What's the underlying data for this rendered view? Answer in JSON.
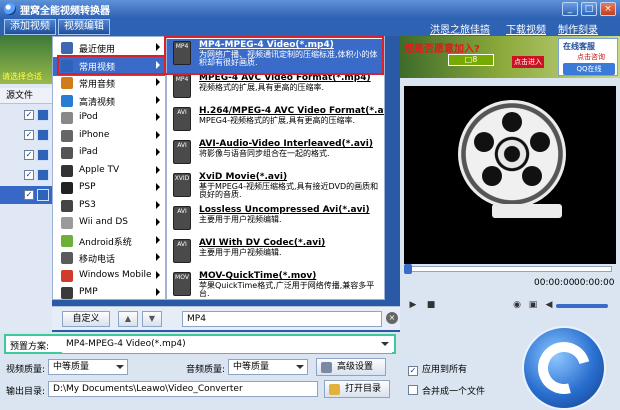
{
  "window": {
    "title": "狸窝全能视频转换器",
    "min": "_",
    "max": "□",
    "close": "×"
  },
  "toolbar": {
    "add_video": "添加视频",
    "edit_video": "视频编辑",
    "links": [
      "洪恩之旅佳搞",
      "下载视频",
      "制作刻录DVD"
    ]
  },
  "left_panel": {
    "ad_text": "请选择合适",
    "file_header": "源文件",
    "check": "✓"
  },
  "categories": [
    {
      "label": "最近使用",
      "icon_color": "#3f66b0",
      "has_arrow": true
    },
    {
      "label": "常用视频",
      "icon_color": "#2d63b8",
      "has_arrow": true,
      "active": true
    },
    {
      "label": "常用音频",
      "icon_color": "#d07b1c",
      "has_arrow": true
    },
    {
      "label": "高清视频",
      "icon_color": "#2a7bd4",
      "has_arrow": true
    },
    {
      "label": "iPod",
      "icon_color": "#888888",
      "has_arrow": true
    },
    {
      "label": "iPhone",
      "icon_color": "#666666",
      "has_arrow": true
    },
    {
      "label": "iPad",
      "icon_color": "#555555",
      "has_arrow": true
    },
    {
      "label": "Apple TV",
      "icon_color": "#333333",
      "has_arrow": true
    },
    {
      "label": "PSP",
      "icon_color": "#222222",
      "has_arrow": true
    },
    {
      "label": "PS3",
      "icon_color": "#444444",
      "has_arrow": true
    },
    {
      "label": "Wii and DS",
      "icon_color": "#9a9a9a",
      "has_arrow": true
    },
    {
      "label": "Android系统",
      "icon_color": "#6ab03a",
      "has_arrow": true
    },
    {
      "label": "移动电话",
      "icon_color": "#5a5a5a",
      "has_arrow": true
    },
    {
      "label": "Windows Mobile",
      "icon_color": "#d13b2b",
      "has_arrow": true
    },
    {
      "label": "PMP",
      "icon_color": "#3a3a3a",
      "has_arrow": true
    }
  ],
  "formats": [
    {
      "name": "MP4-MPEG-4 Video(*.mp4)",
      "desc": "为网络广播、视频通讯定制的压缩标准,体积小的体积却有很好画质.",
      "icon": "MP4",
      "active": true
    },
    {
      "name": "MPEG-4 AVC Video Format(*.mp4)",
      "desc": "视频格式的扩展,具有更高的压缩率.",
      "icon": "MP4"
    },
    {
      "name": "H.264/MPEG-4 AVC Video Format(*.avi)",
      "desc": "MPEG4-视频格式的扩展,具有更高的压缩率.",
      "icon": "AVI"
    },
    {
      "name": "AVI-Audio-Video Interleaved(*.avi)",
      "desc": "将影像与语音同步组合在一起的格式.",
      "icon": "AVI"
    },
    {
      "name": "XviD Movie(*.avi)",
      "desc": "基于MPEG4-视频压缩格式,具有接近DVD的画质和良好的音质.",
      "icon": "XVID"
    },
    {
      "name": "Lossless Uncompressed Avi(*.avi)",
      "desc": "主要用于用户视频编辑.",
      "icon": "AVI"
    },
    {
      "name": "AVI With DV Codec(*.avi)",
      "desc": "主要用于用户视频编辑.",
      "icon": "AVI"
    },
    {
      "name": "MOV-QuickTime(*.mov)",
      "desc": "苹果QuickTime格式,广泛用于网络传播,兼容多平台.",
      "icon": "MOV"
    }
  ],
  "format_bar": {
    "custom": "自定义",
    "up": "▲",
    "down": "▼",
    "search_value": "MP4",
    "clear": "×"
  },
  "settings": {
    "preset_label": "预置方案:",
    "preset_value": "MP4-MPEG-4 Video(*.mp4)",
    "video_quality_label": "视频质量:",
    "video_quality_value": "中等质量",
    "audio_quality_label": "音频质量:",
    "audio_quality_value": "中等质量",
    "advanced_button": "高级设置",
    "apply_all_label": "应用到所有",
    "output_label": "输出目录:",
    "output_value": "D:\\My Documents\\Leawo\\Video_Converter",
    "open_dir_button": "打开目录",
    "merge_label": "合并成一个文件"
  },
  "right_panel": {
    "banner_text": "您是否愿意加入?",
    "banner_sub": "□8",
    "banner_tag": "点击进入",
    "support_title": "在线客服",
    "support_link": "点击咨询",
    "qq_button": "QQ在线",
    "time_current": "00:00:00",
    "time_total": "00:00:00",
    "play": "▶",
    "stop": "■",
    "snapshot": "◉",
    "folder": "▣",
    "volume": "◀"
  },
  "colors": {
    "accent": "#3a6bc9",
    "highlight_red": "#d9212b",
    "highlight_green": "#3ec99a"
  }
}
